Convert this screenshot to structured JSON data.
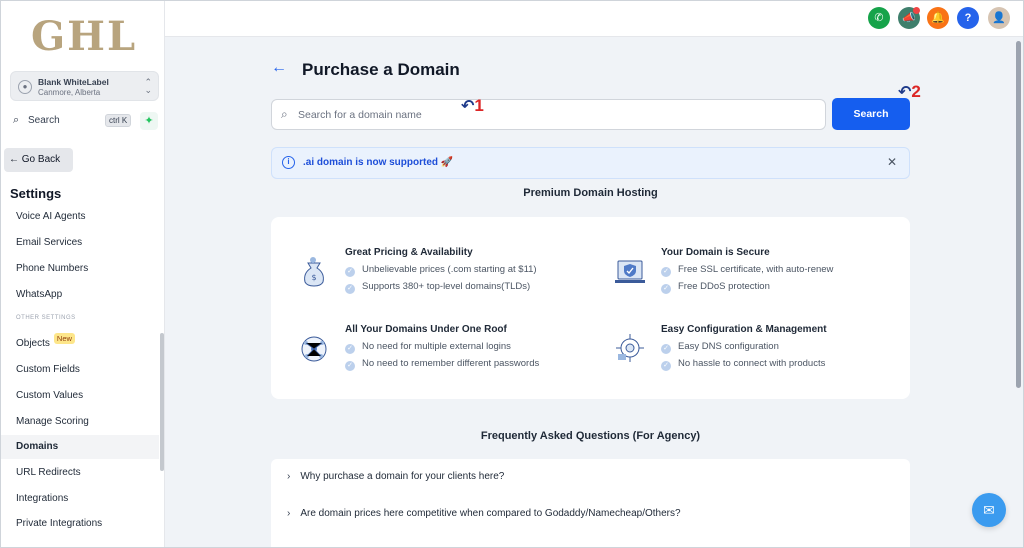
{
  "brand": {
    "logo": "GHL"
  },
  "account": {
    "name": "Blank WhiteLabel",
    "location": "Canmore, Alberta"
  },
  "sidebar_search": {
    "label": "Search",
    "shortcut": "ctrl K"
  },
  "go_back": "Go Back",
  "settings_title": "Settings",
  "nav_items": [
    "Voice AI Agents",
    "Email Services",
    "Phone Numbers",
    "WhatsApp"
  ],
  "other_settings_label": "OTHER SETTINGS",
  "other_items": [
    {
      "label": "Objects",
      "badge": "New"
    },
    {
      "label": "Custom Fields"
    },
    {
      "label": "Custom Values"
    },
    {
      "label": "Manage Scoring"
    },
    {
      "label": "Domains",
      "active": true
    },
    {
      "label": "URL Redirects"
    },
    {
      "label": "Integrations"
    },
    {
      "label": "Private Integrations"
    }
  ],
  "topbar": {
    "help_label": "?"
  },
  "page": {
    "title": "Purchase a Domain",
    "search_placeholder": "Search for a domain name",
    "search_button": "Search",
    "annotation_1": "1",
    "annotation_2": "2",
    "banner": ".ai domain is now supported 🚀",
    "premium_title": "Premium Domain Hosting",
    "features": [
      {
        "title": "Great Pricing & Availability",
        "points": [
          "Unbelievable prices (.com starting at $11)",
          "Supports 380+ top-level domains(TLDs)"
        ],
        "icon": "money-bag-icon"
      },
      {
        "title": "Your Domain is Secure",
        "points": [
          "Free SSL certificate, with auto-renew",
          "Free DDoS protection"
        ],
        "icon": "secure-laptop-icon"
      },
      {
        "title": "All Your Domains Under One Roof",
        "points": [
          "No need for multiple external logins",
          "No need to remember different passwords"
        ],
        "icon": "globe-network-icon"
      },
      {
        "title": "Easy Configuration & Management",
        "points": [
          "Easy DNS configuration",
          "No hassle to connect with products"
        ],
        "icon": "config-gear-icon"
      }
    ],
    "faq_title": "Frequently Asked Questions (For Agency)",
    "faq": [
      "Why purchase a domain for your clients here?",
      "Are domain prices here competitive when compared to Godaddy/Namecheap/Others?"
    ]
  },
  "colors": {
    "primary": "#155eef",
    "logo": "#b8a47e",
    "banner_bg": "#eaf2fd"
  }
}
